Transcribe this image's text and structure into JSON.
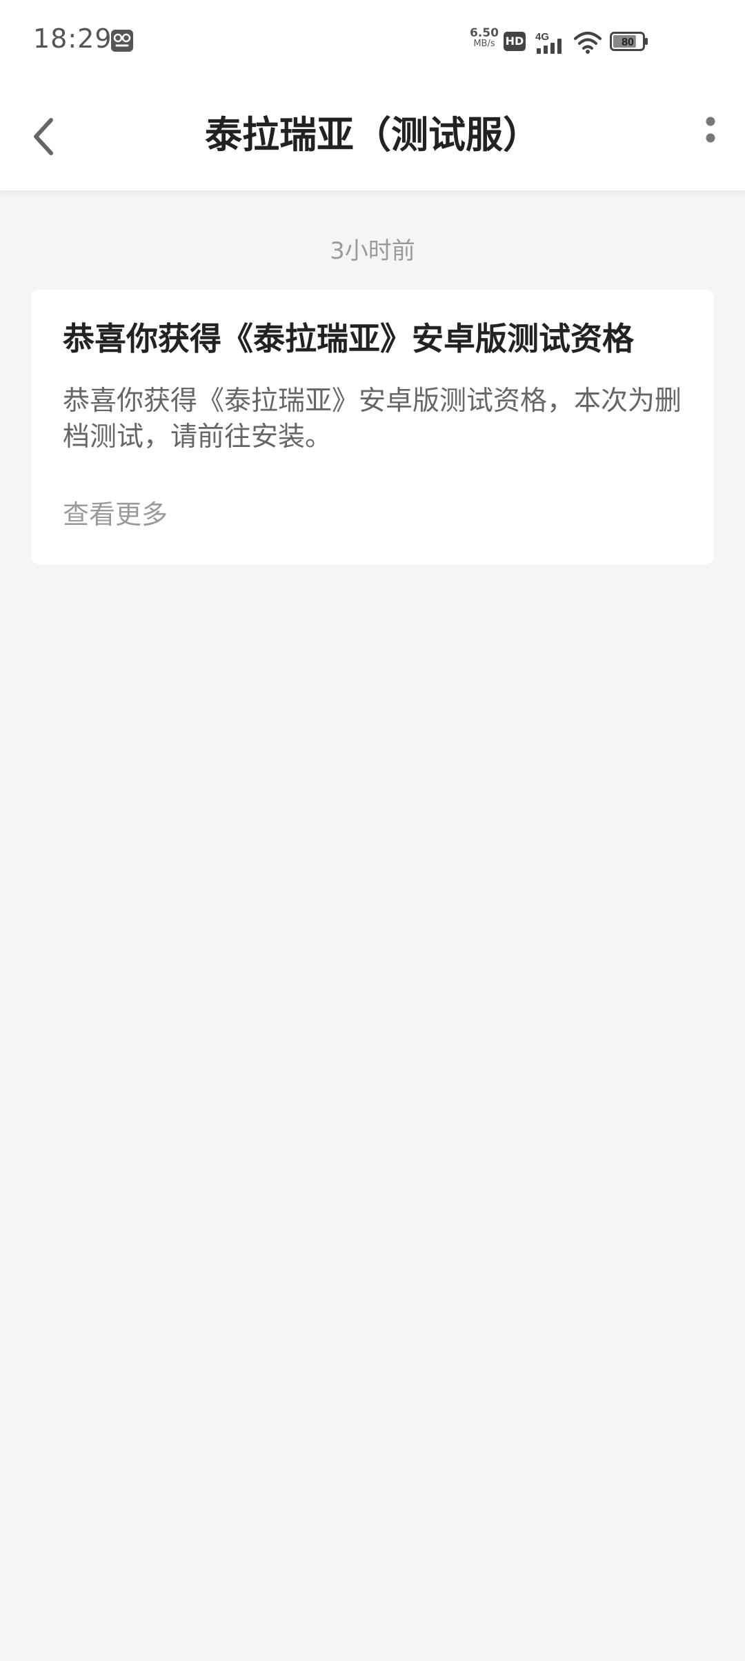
{
  "status_bar": {
    "time": "18:29",
    "net_speed_value": "6.50",
    "net_speed_unit": "MB/s",
    "hd_label": "HD",
    "network_type": "4G",
    "battery_level": "80",
    "battery_fraction": 0.8,
    "app_icon": "app-notification-icon"
  },
  "nav": {
    "title": "泰拉瑞亚（测试服）",
    "back_icon": "chevron-left-icon",
    "more_icon": "more-vertical-icon"
  },
  "message": {
    "time": "3小时前",
    "title": "恭喜你获得《泰拉瑞亚》安卓版测试资格",
    "body": "恭喜你获得《泰拉瑞亚》安卓版测试资格，本次为删档测试，请前往安装。",
    "more_label": "查看更多"
  },
  "colors": {
    "background": "#f4f5f7",
    "card": "#ffffff",
    "title_text": "#222222",
    "body_text": "#666666",
    "muted_text": "#9a9a9a"
  }
}
